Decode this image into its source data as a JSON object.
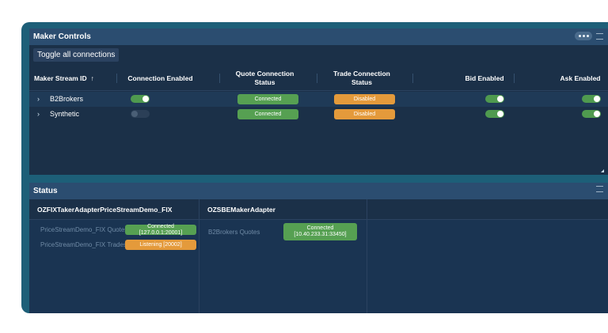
{
  "maker": {
    "title": "Maker Controls",
    "toggle_all": "Toggle all connections",
    "columns": {
      "stream_id": "Maker Stream ID",
      "sort_arrow": "↑",
      "connection_enabled": "Connection Enabled",
      "quote_status": "Quote Connection Status",
      "trade_status": "Trade Connection Status",
      "bid_enabled": "Bid Enabled",
      "ask_enabled": "Ask Enabled"
    },
    "rows": [
      {
        "name": "B2Brokers",
        "expand": "›",
        "connection_enabled": true,
        "quote": "Connected",
        "trade": "Disabled",
        "bid": true,
        "ask": true
      },
      {
        "name": "Synthetic",
        "expand": "›",
        "connection_enabled": false,
        "quote": "Connected",
        "trade": "Disabled",
        "bid": true,
        "ask": true
      }
    ]
  },
  "status": {
    "title": "Status",
    "adapters": [
      {
        "name": "OZFIXTakerAdapterPriceStreamDemo_FIX",
        "lines": [
          {
            "label": "PriceStreamDemo_FIX Quotes",
            "value": "Connected [127.0.0.1:20001]"
          },
          {
            "label": "PriceStreamDemo_FIX Trades",
            "value": "Listening [20002]"
          }
        ]
      },
      {
        "name": "OZSBEMakerAdapter",
        "lines": [
          {
            "label": "B2Brokers Quotes",
            "value": "Connected\n[10.40.233.31:33450]"
          }
        ]
      }
    ]
  },
  "colors": {
    "connected": "#56a052",
    "warning": "#e49a3b",
    "header": "#2b4d70",
    "panel": "#1b3048"
  },
  "icons": [
    "more-icon",
    "menu-icon",
    "sort-up-icon",
    "chevron-right-icon",
    "resize-handle-icon"
  ]
}
